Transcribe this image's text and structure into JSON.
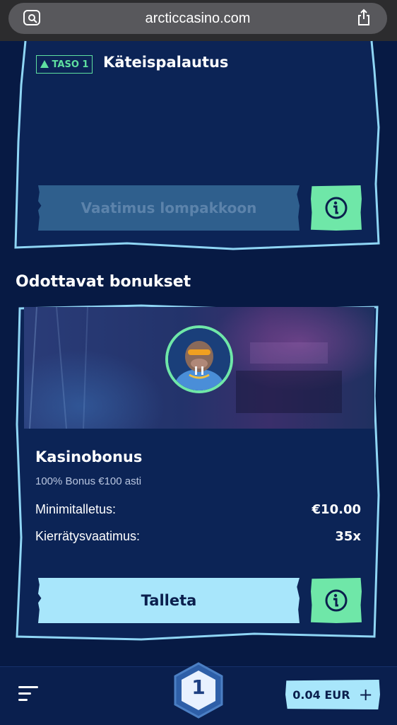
{
  "browser": {
    "url": "arcticcasino.com"
  },
  "cashback_card": {
    "tier_label": "TASO 1",
    "title": "Käteispalautus",
    "claim_button": "Vaatimus lompakkoon"
  },
  "pending_section": {
    "title": "Odottavat bonukset"
  },
  "bonus_card": {
    "title": "Kasinobonus",
    "subtitle": "100% Bonus €100 asti",
    "rows": [
      {
        "label": "Minimitalletus:",
        "value": "€10.00"
      },
      {
        "label": "Kierrätysvaatimus:",
        "value": "35x"
      }
    ],
    "deposit_button": "Talleta"
  },
  "bottom_bar": {
    "level": "1",
    "balance": "0.04 EUR",
    "add_symbol": "+"
  },
  "colors": {
    "background": "#071a44",
    "accent_green": "#6fe7a8",
    "accent_light_blue": "#a8e6fb",
    "card_border": "#8fd6f5"
  }
}
